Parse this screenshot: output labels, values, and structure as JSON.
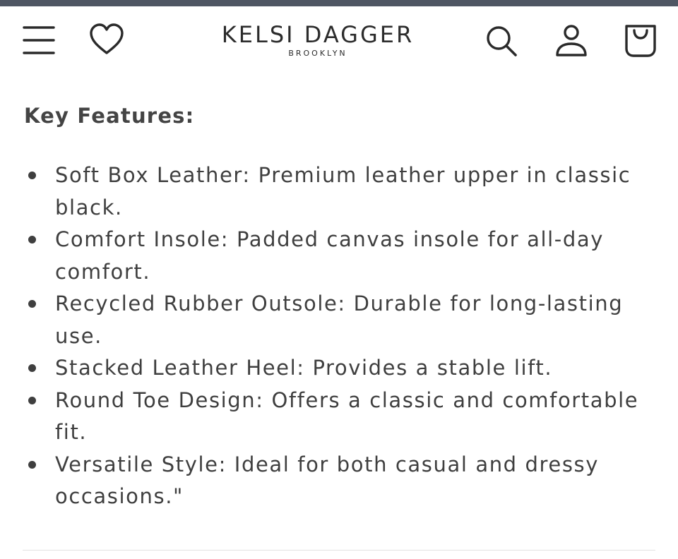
{
  "brand": {
    "name": "KELSI DAGGER",
    "location": "BROOKLYN"
  },
  "header": {
    "icons": [
      "menu-icon",
      "heart-icon",
      "search-icon",
      "user-icon",
      "shopping-bag-icon"
    ]
  },
  "section": {
    "heading": "Key Features:",
    "features": [
      "Soft Box Leather: Premium leather upper in classic black.",
      "Comfort Insole: Padded canvas insole for all-day comfort.",
      "Recycled Rubber Outsole: Durable for long-lasting use.",
      "Stacked Leather Heel: Provides a stable lift.",
      "Round Toe Design: Offers a classic and comfortable fit.",
      "Versatile Style: Ideal for both casual and dressy occasions.\""
    ]
  },
  "colors": {
    "top_bar": "#4f5663",
    "text": "#3f3f3f",
    "divider": "#e2e2e2"
  }
}
